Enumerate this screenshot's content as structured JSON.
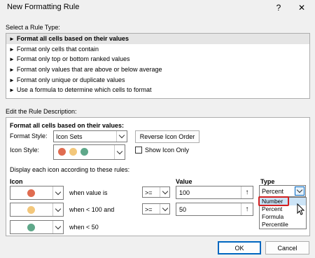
{
  "window": {
    "title": "New Formatting Rule",
    "help_label": "?",
    "close_label": "✕"
  },
  "rule_type": {
    "section_label": "Select a Rule Type:",
    "bullet": "►",
    "items": [
      "Format all cells based on their values",
      "Format only cells that contain",
      "Format only top or bottom ranked values",
      "Format only values that are above or below average",
      "Format only unique or duplicate values",
      "Use a formula to determine which cells to format"
    ],
    "selected_index": 0
  },
  "description": {
    "section_label": "Edit the Rule Description:",
    "heading": "Format all cells based on their values:",
    "format_style_label": "Format Style:",
    "format_style_value": "Icon Sets",
    "reverse_icon_order_label": "Reverse Icon Order",
    "icon_style_label": "Icon Style:",
    "show_icon_only_label": "Show Icon Only",
    "show_icon_only_checked": false,
    "display_rules_label": "Display each icon according to these rules:",
    "col_icon": "Icon",
    "col_value": "Value",
    "col_type": "Type",
    "rules": [
      {
        "icon_color": "#e06c50",
        "condition": "when value is",
        "operator": ">=",
        "value": "100",
        "type": "Percent"
      },
      {
        "icon_color": "#f3c77b",
        "condition": "when < 100 and",
        "operator": ">=",
        "value": "50",
        "type": ""
      },
      {
        "icon_color": "#5fa88a",
        "condition": "when < 50",
        "operator": "",
        "value": "",
        "type": ""
      }
    ],
    "icon_style_colors": [
      "#e06c50",
      "#f3c77b",
      "#5fa88a"
    ],
    "type_dropdown_options": [
      "Number",
      "Percent",
      "Formula",
      "Percentile"
    ],
    "type_dropdown_highlighted": "Number"
  },
  "footer": {
    "ok_label": "OK",
    "cancel_label": "Cancel"
  },
  "colors": {
    "accent_blue": "#0067c0",
    "highlight_red": "#d21f1f",
    "selected_row": "#e5e5e5"
  }
}
